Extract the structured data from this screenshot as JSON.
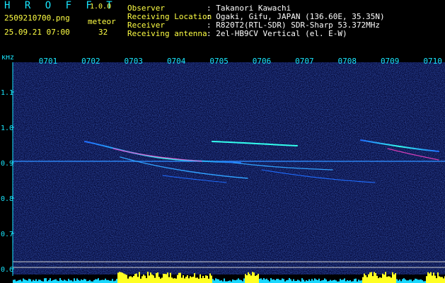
{
  "header": {
    "app_name": "H R O F F T",
    "version": "1.0.0",
    "filename": "2509210700.png",
    "datetime": "25.09.21 07:00",
    "meteor_label": "meteor",
    "meteor_count": "32"
  },
  "info": [
    {
      "label": "Observer",
      "value": ": Takanori Kawachi"
    },
    {
      "label": "Receiving Location",
      "value": ": Ogaki, Gifu, JAPAN (136.60E, 35.35N)"
    },
    {
      "label": "Receiver",
      "value": ": R820T2(RTL-SDR) SDR-Sharp 53.372MHz"
    },
    {
      "label": "Receiving antenna",
      "value": ": 2el-HB9CV Vertical (el. E-W)"
    }
  ],
  "spectrogram": {
    "y_unit": "kHz",
    "y_ticks": [
      "1.1",
      "1.0",
      "0.9",
      "0.8",
      "0.7",
      "0.6"
    ],
    "x_ticks": [
      "0701",
      "0702",
      "0703",
      "0704",
      "0705",
      "0706",
      "0707",
      "0708",
      "0709",
      "0710"
    ]
  },
  "colors": {
    "background": "#000000",
    "axis": "#19e6ff",
    "label": "#ffff44",
    "noise": "#0a1a6e"
  }
}
